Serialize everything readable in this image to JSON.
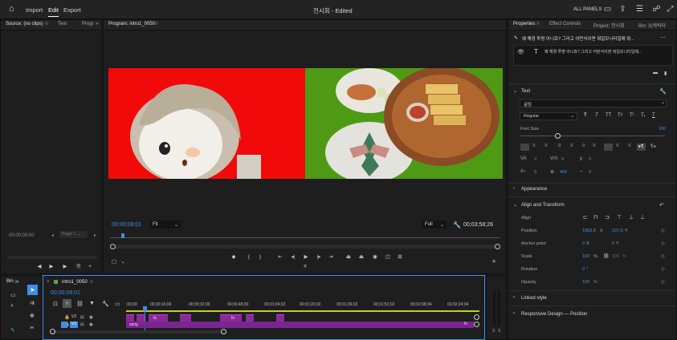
{
  "topbar": {
    "nav": [
      "Import",
      "Edit",
      "Export"
    ],
    "active_nav": "Edit",
    "title": "전시회 - Edited",
    "all_panels": "ALL PANELS"
  },
  "source_panel": {
    "tabs": [
      "Source: (no clips)",
      "Text",
      "Progr"
    ],
    "timecode": "00;00;00;00",
    "page": "Page 1"
  },
  "program_monitor": {
    "tab": "Program: intro1_0050",
    "current_time": "00;00;08;01",
    "fit": "Fit",
    "quality": "Full",
    "duration": "00;03;58;26"
  },
  "properties_panel": {
    "tabs": [
      "Properties",
      "Effect Controls",
      "Project: 전시회",
      "Bin: 3(캐릭터"
    ],
    "clip_title": "왜 해경 투명 아니죠? 그리고 어떤식이면 뭐일모니터일때 뭐...",
    "text_layer": "왜 해경 투명 아니죠? 그리고 어떤식이면 뭐일모니터일때...",
    "text_section": "Text",
    "font": "굴림",
    "font_style": "Regular",
    "font_size_label": "Font Size",
    "font_size_value": "100",
    "tracking": "0",
    "kerning": "0",
    "leading": "0",
    "line_spacing": "400",
    "baseline": "0",
    "appearance": "Appearance",
    "align_transform": "Align and Transform",
    "align_label": "Align",
    "position_label": "Position",
    "position_x": "1958.8",
    "position_y": "197.5",
    "anchor_label": "Anchor point",
    "anchor_x": "0",
    "anchor_y": "0",
    "scale_label": "Scale",
    "scale_value": "100",
    "scale_value2": "100",
    "rotation_label": "Rotation",
    "rotation_value": "0",
    "opacity_label": "Opacity",
    "opacity_value": "100",
    "linked_style": "Linked style",
    "responsive": "Responsive Design — Position"
  },
  "timeline": {
    "tab": "intro1_0050",
    "bin_tab": "Bin",
    "timecode": "00;00;08;01",
    "ruler": [
      ";00;00",
      "00;00;16;00",
      "00;00;32;00",
      "00;00;48;00",
      "00;01;04;02",
      "00;01;20;02",
      "00;01;36;02",
      "00;01;52;02",
      "00;02;08;04",
      "00;02;24;04"
    ],
    "tracks": [
      "V2",
      "V1"
    ],
    "clip_label": "sprig",
    "fx_label": "fx"
  },
  "audio_meter": {
    "labels": [
      "S",
      "S"
    ]
  },
  "colors": {
    "accent": "#3d8ee8",
    "clip": "#8a2a9a",
    "red": "#f20a0a",
    "green": "#4f9a14"
  }
}
